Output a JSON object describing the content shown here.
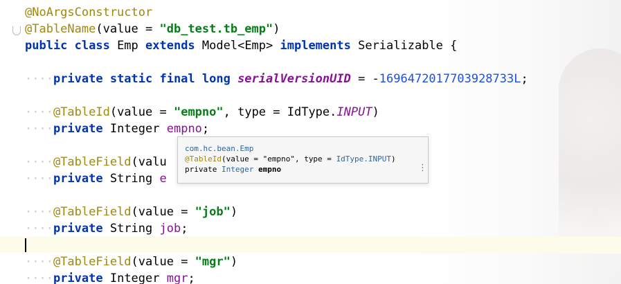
{
  "editor": {
    "lines": [
      {
        "id": "l0",
        "parts": [
          {
            "t": "@NoArgsConstructor",
            "c": "ann"
          }
        ]
      },
      {
        "id": "l1",
        "parts": [
          {
            "t": "@TableName",
            "c": "ann"
          },
          {
            "t": "(value = ",
            "c": "cls"
          },
          {
            "t": "\"db_test.tb_emp\"",
            "c": "str"
          },
          {
            "t": ")",
            "c": "cls"
          }
        ]
      },
      {
        "id": "l2",
        "parts": [
          {
            "t": "public class ",
            "c": "kw"
          },
          {
            "t": "Emp ",
            "c": "cls"
          },
          {
            "t": "extends ",
            "c": "kw"
          },
          {
            "t": "Model<Emp> ",
            "c": "cls"
          },
          {
            "t": "implements ",
            "c": "kw"
          },
          {
            "t": "Serializable {",
            "c": "cls"
          }
        ]
      },
      {
        "id": "l3",
        "parts": []
      },
      {
        "id": "l4",
        "parts": [
          {
            "t": "····",
            "c": "ws"
          },
          {
            "t": "private static final long ",
            "c": "kw"
          },
          {
            "t": "serialVersionUID",
            "c": "static-italic"
          },
          {
            "t": " = -",
            "c": "cls"
          },
          {
            "t": "1696472017703928733L",
            "c": "num"
          },
          {
            "t": ";",
            "c": "cls"
          }
        ]
      },
      {
        "id": "l5",
        "parts": []
      },
      {
        "id": "l6",
        "parts": [
          {
            "t": "····",
            "c": "ws"
          },
          {
            "t": "@TableId",
            "c": "ann"
          },
          {
            "t": "(value = ",
            "c": "cls"
          },
          {
            "t": "\"empno\"",
            "c": "str"
          },
          {
            "t": ", type = IdType.",
            "c": "cls"
          },
          {
            "t": "INPUT",
            "c": "enumconst"
          },
          {
            "t": ")",
            "c": "cls"
          }
        ]
      },
      {
        "id": "l7",
        "parts": [
          {
            "t": "····",
            "c": "ws"
          },
          {
            "t": "private ",
            "c": "kw"
          },
          {
            "t": "Integer ",
            "c": "cls"
          },
          {
            "t": "empno",
            "c": "fieldname"
          },
          {
            "t": ";",
            "c": "cls"
          }
        ]
      },
      {
        "id": "l8",
        "parts": []
      },
      {
        "id": "l9",
        "parts": [
          {
            "t": "····",
            "c": "ws"
          },
          {
            "t": "@TableField",
            "c": "ann"
          },
          {
            "t": "(valu",
            "c": "cls"
          }
        ]
      },
      {
        "id": "l10",
        "parts": [
          {
            "t": "····",
            "c": "ws"
          },
          {
            "t": "private ",
            "c": "kw"
          },
          {
            "t": "String ",
            "c": "cls"
          },
          {
            "t": "e",
            "c": "fieldname"
          }
        ]
      },
      {
        "id": "l11",
        "parts": []
      },
      {
        "id": "l12",
        "parts": [
          {
            "t": "····",
            "c": "ws"
          },
          {
            "t": "@TableField",
            "c": "ann"
          },
          {
            "t": "(value = ",
            "c": "cls"
          },
          {
            "t": "\"job\"",
            "c": "str"
          },
          {
            "t": ")",
            "c": "cls"
          }
        ]
      },
      {
        "id": "l13",
        "parts": [
          {
            "t": "····",
            "c": "ws"
          },
          {
            "t": "private ",
            "c": "kw"
          },
          {
            "t": "String ",
            "c": "cls"
          },
          {
            "t": "job",
            "c": "fieldname"
          },
          {
            "t": ";",
            "c": "cls"
          }
        ]
      },
      {
        "id": "l14",
        "parts": [],
        "caret": true
      },
      {
        "id": "l15",
        "parts": [
          {
            "t": "····",
            "c": "ws"
          },
          {
            "t": "@TableField",
            "c": "ann"
          },
          {
            "t": "(value = ",
            "c": "cls"
          },
          {
            "t": "\"mgr\"",
            "c": "str"
          },
          {
            "t": ")",
            "c": "cls"
          }
        ]
      },
      {
        "id": "l16",
        "parts": [
          {
            "t": "····",
            "c": "ws"
          },
          {
            "t": "private ",
            "c": "kw"
          },
          {
            "t": "Integer ",
            "c": "cls"
          },
          {
            "t": "mgr",
            "c": "fieldname"
          },
          {
            "t": ";",
            "c": "cls"
          }
        ]
      }
    ]
  },
  "popup": {
    "line1": "com.hc.bean.Emp",
    "line2_ann": "@TableId",
    "line2_rest_a": "(value = \"empno\", type = ",
    "line2_type": "IdType.INPUT",
    "line2_rest_b": ")",
    "line3_kw": "private ",
    "line3_type": "Integer ",
    "line3_name": "empno",
    "more_icon": "⋮"
  },
  "colors": {
    "annotation": "#9e880d",
    "keyword": "#0033b3",
    "string": "#067d17",
    "number": "#1750eb",
    "field": "#871094",
    "caret_line_bg": "#fdfbe9"
  }
}
